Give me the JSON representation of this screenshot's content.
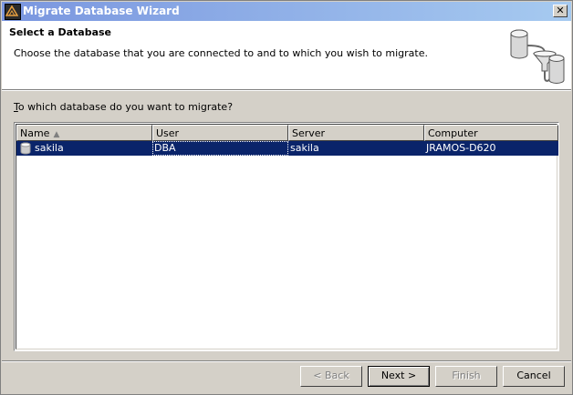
{
  "window": {
    "title": "Migrate Database Wizard",
    "close_glyph": "✕"
  },
  "header": {
    "title": "Select a Database",
    "description": "Choose the database that you are connected to and to which you wish to migrate.",
    "icon": "database-migrate-icon"
  },
  "question": {
    "mnemonic": "T",
    "text": "o which database do you want to migrate?"
  },
  "table": {
    "columns": [
      "Name",
      "User",
      "Server",
      "Computer"
    ],
    "sort_column": "Name",
    "sort_direction": "ascending",
    "rows": [
      {
        "name": "sakila",
        "user": "DBA",
        "server": "sakila",
        "computer": "JRAMOS-D620",
        "selected": true
      }
    ]
  },
  "buttons": {
    "back": {
      "label": "< Back",
      "mnemonic": "B",
      "enabled": false
    },
    "next": {
      "label": "Next >",
      "mnemonic": "N",
      "enabled": true
    },
    "finish": {
      "label": "Finish",
      "enabled": false
    },
    "cancel": {
      "label": "Cancel",
      "enabled": true
    }
  },
  "colors": {
    "selection": "#0a246a",
    "title_gradient_start": "#7a96df",
    "title_gradient_end": "#a6caf0",
    "dialog_bg": "#d4d0c8"
  }
}
